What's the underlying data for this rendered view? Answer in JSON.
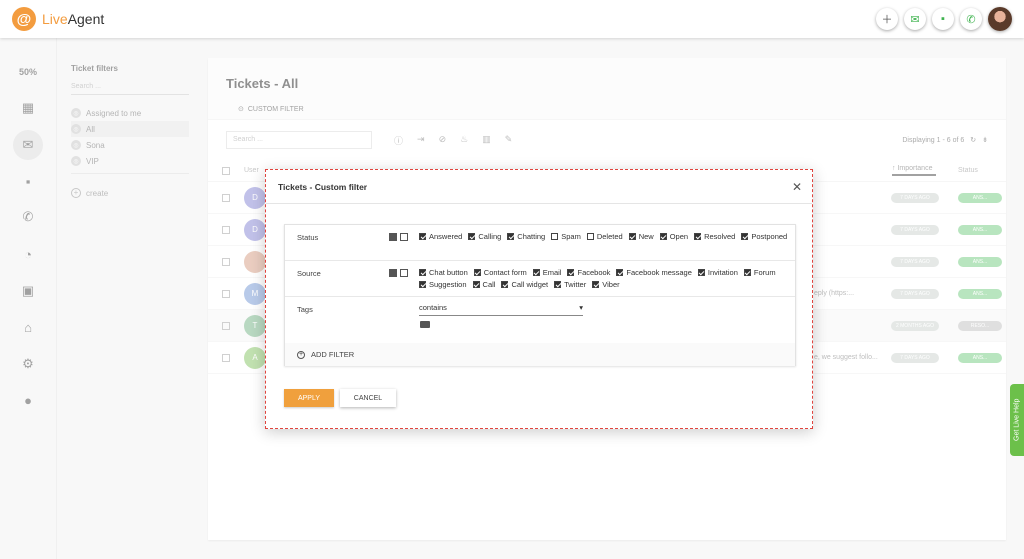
{
  "app": {
    "logo_letter": "@",
    "name_part1": "Live",
    "name_part2": "Agent",
    "zoom": "50%",
    "brand_color": "#f39c3f"
  },
  "topbar": {
    "icons": [
      "plus-icon",
      "mail-icon",
      "chat-icon",
      "phone-icon"
    ]
  },
  "nav": {
    "icons": [
      "dashboard-icon",
      "mail-icon",
      "chat-icon",
      "phone-icon",
      "reports-icon",
      "contacts-icon",
      "knowledgebase-icon",
      "settings-icon",
      "plugins-icon"
    ]
  },
  "filters_panel": {
    "title": "Ticket filters",
    "search_placeholder": "Search ...",
    "items": [
      {
        "label": "Assigned to me"
      },
      {
        "label": "All"
      },
      {
        "label": "Sona"
      },
      {
        "label": "VIP"
      }
    ],
    "create_label": "create"
  },
  "main": {
    "title": "Tickets - All",
    "custom_filter_label": "CUSTOM FILTER",
    "search_placeholder": "Search ...",
    "displaying": "Displaying 1 - 6 of 6",
    "col_user": "User",
    "col_importance": "↑ Importance",
    "col_status": "Status",
    "rows": [
      {
        "initial": "D",
        "color": "#8f8fd8",
        "snippet": "",
        "time": "7 DAYS AGO",
        "status": "ANS..."
      },
      {
        "initial": "D",
        "color": "#8f8fd8",
        "snippet": "",
        "time": "7 DAYS AGO",
        "status": "ANS..."
      },
      {
        "initial": "",
        "color": "#d9a48c",
        "snippet": "",
        "time": "7 DAYS AGO",
        "status": "ANS..."
      },
      {
        "initial": "M",
        "color": "#7f9fd8",
        "snippet": "eply (https:...",
        "time": "7 DAYS AGO",
        "status": "ANS..."
      },
      {
        "initial": "T",
        "color": "#7fb88f",
        "snippet": "",
        "time": "2 MONTHS AGO",
        "status": "RESO..."
      },
      {
        "initial": "A",
        "color": "#8fc86f",
        "snippet": "e, we suggest follo...",
        "time": "7 DAYS AGO",
        "status": "ANS..."
      }
    ]
  },
  "modal": {
    "title": "Tickets - Custom filter",
    "status_label": "Status",
    "status_options": [
      {
        "label": "Answered",
        "checked": true
      },
      {
        "label": "Calling",
        "checked": true
      },
      {
        "label": "Chatting",
        "checked": true
      },
      {
        "label": "Spam",
        "checked": false
      },
      {
        "label": "Deleted",
        "checked": false
      },
      {
        "label": "New",
        "checked": true
      },
      {
        "label": "Open",
        "checked": true
      },
      {
        "label": "Resolved",
        "checked": true
      },
      {
        "label": "Postponed",
        "checked": true
      }
    ],
    "source_label": "Source",
    "source_options": [
      {
        "label": "Chat button",
        "checked": true
      },
      {
        "label": "Contact form",
        "checked": true
      },
      {
        "label": "Email",
        "checked": true
      },
      {
        "label": "Facebook",
        "checked": true
      },
      {
        "label": "Facebook message",
        "checked": true
      },
      {
        "label": "Invitation",
        "checked": true
      },
      {
        "label": "Forum",
        "checked": true
      },
      {
        "label": "Suggestion",
        "checked": true
      },
      {
        "label": "Call",
        "checked": true
      },
      {
        "label": "Call widget",
        "checked": true
      },
      {
        "label": "Twitter",
        "checked": true
      },
      {
        "label": "Viber",
        "checked": true
      }
    ],
    "tags_label": "Tags",
    "tags_operator": "contains",
    "add_filter_label": "ADD FILTER",
    "apply_label": "APPLY",
    "cancel_label": "CANCEL"
  },
  "live_help": "Get Live Help"
}
